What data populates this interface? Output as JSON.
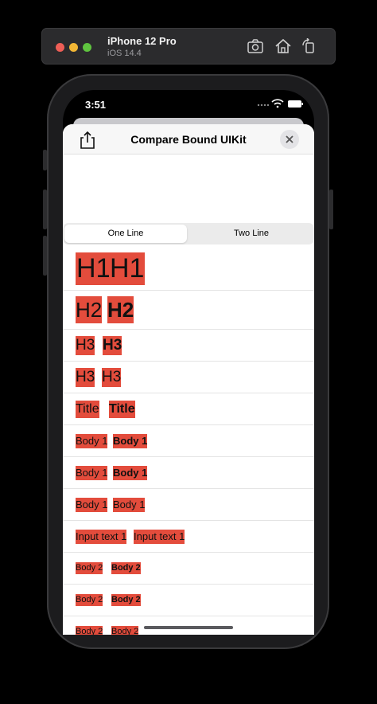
{
  "simulator": {
    "device": "iPhone 12 Pro",
    "os": "iOS 14.4",
    "icons": [
      "screenshot-icon",
      "home-icon",
      "rotate-icon"
    ]
  },
  "status_bar": {
    "time": "3:51"
  },
  "sheet": {
    "title": "Compare Bound UIKit",
    "share_icon": "share-icon",
    "close_icon": "close-icon"
  },
  "segments": [
    "One Line",
    "Two Line"
  ],
  "selected_segment": "One Line",
  "rows": [
    {
      "style": "H1",
      "regular": "H1",
      "bold": "H1"
    },
    {
      "style": "H2",
      "regular": "H2",
      "bold": "H2"
    },
    {
      "style": "H3",
      "regular": "H3",
      "bold": "H3"
    },
    {
      "style": "H3",
      "regular": "H3",
      "bold": "H3"
    },
    {
      "style": "Title",
      "regular": "Title",
      "bold": "Title"
    },
    {
      "style": "Body 1",
      "regular": "Body 1",
      "bold": "Body 1"
    },
    {
      "style": "Body 1",
      "regular": "Body 1",
      "bold": "Body 1"
    },
    {
      "style": "Body 1",
      "regular": "Body 1",
      "bold": "Body 1"
    },
    {
      "style": "Input text 1",
      "regular": "Input text 1",
      "bold": "Input text 1"
    },
    {
      "style": "Body 2",
      "regular": "Body 2",
      "bold": "Body 2"
    },
    {
      "style": "Body 2",
      "regular": "Body 2",
      "bold": "Body 2"
    },
    {
      "style": "Body 2",
      "regular": "Body 2",
      "bold": "Body 2"
    }
  ],
  "colors": {
    "label_highlight": "#e34c3c",
    "background": "#000000",
    "sheet": "#ffffff"
  }
}
